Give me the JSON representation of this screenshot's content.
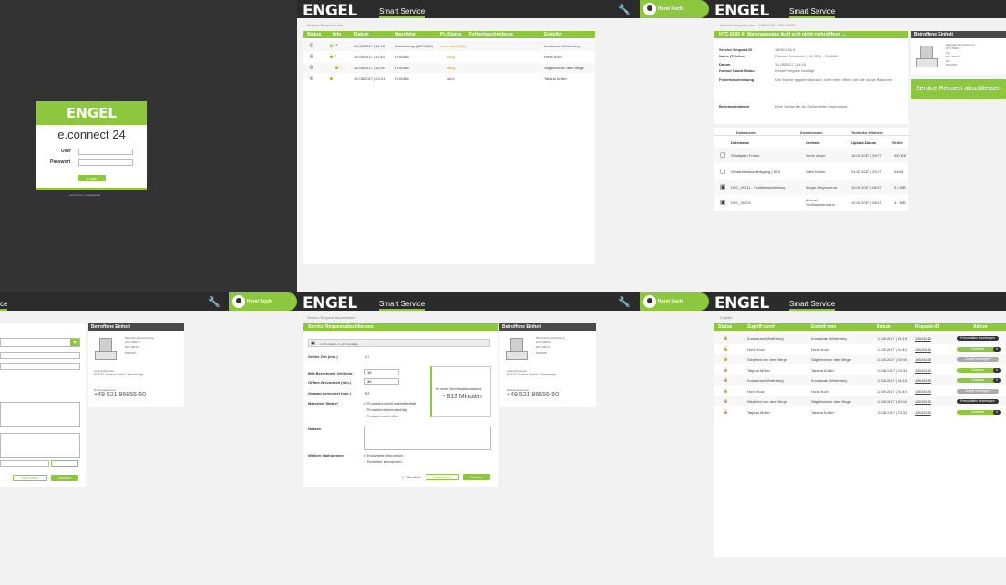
{
  "brand": "ENGEL",
  "nav_title": "Smart Service",
  "user": "Horst Koch",
  "login": {
    "logo": "ENGEL",
    "title": "e.connect 24",
    "user_label": "User",
    "password_label": "Passwort",
    "login_button": "Login",
    "powered": "powered by"
  },
  "list": {
    "breadcrumb": "Service Request Liste",
    "columns": [
      "Status",
      "Info",
      "Datum",
      "Maschine",
      "Pr.-Status",
      "Fehlerbeschreibung",
      "Ersteller"
    ],
    "rows": [
      {
        "datum": "11.08.2017 | 14:15",
        "maschine": "Maschinetyp (8874456)",
        "prio": "noch nicht fällig",
        "prio_color": "#e0a020",
        "ersteller": "Konstanze Winterberg"
      },
      {
        "datum": "11.08.2017 | 11:44",
        "maschine": "8741068",
        "prio": "fällig",
        "prio_color": "#e0a020",
        "ersteller": "Horst Koch"
      },
      {
        "datum": "11.08.2017 | 11:04",
        "maschine": "8741068",
        "prio": "fällig",
        "prio_color": "#e0a020",
        "ersteller": "Siegfried von dem Berge"
      },
      {
        "datum": "10.08.2017 | 23:31",
        "maschine": "8741068",
        "prio": "akut",
        "prio_color": "#e03030",
        "ersteller": "Tatjana Müller"
      }
    ]
  },
  "detail": {
    "breadcrumb": "Service Request Liste · 18054135 · HTC-5600",
    "header": "HTC-5600 X: Warenausgabe läuft sich nicht mehr öffnen ...",
    "fields": [
      {
        "label": "Service Request ID",
        "value": "18054135 A"
      },
      {
        "label": "Name (Telefon)",
        "value": "Renate Schneider (+49 521) - 9966500"
      },
      {
        "label": "Datum",
        "value": "11.08.2017 | 14:15"
      },
      {
        "label": "Konsul Guard Status",
        "value": "Keine Freigabe benötigt"
      },
      {
        "label": "Fehlerbeschreibung",
        "value": "Die Wanne eggabe lässt sich nicht mehr öffnen und die ganze Maschine"
      },
      {
        "label": "Begemaßnahmen",
        "value": "Eine Sichtprüfe der Sicherheiten ergebnislos"
      }
    ],
    "tabs": [
      "Dokumente",
      "Kommentare",
      "Techniker-Historie"
    ],
    "doc_cols": [
      "Dateiname",
      "Verfasst",
      "Upload-Datum",
      "Größe"
    ],
    "docs": [
      {
        "name": "Schaltplan Fronts",
        "by": "Horst Meyer",
        "date": "15.03.2017 | 09:27",
        "size": "450 KB"
      },
      {
        "name": "Gewährleistsanfertigung (.NO)",
        "by": "Gabi Körber",
        "date": "24.02.2017 | 09:27",
        "size": "54 kB"
      },
      {
        "name": "DSC_00211 - Fehlerbeschreibung",
        "by": "Jürgen Heymonroid",
        "date": "10.03.2017 | 08:37",
        "size": "3.2 MB"
      },
      {
        "name": "DSC_00224",
        "by": "Michael Großwassermann",
        "date": "10.03.2017 | 08:37",
        "size": "3.1 MB"
      }
    ],
    "unit_header": "Betroffene Einheit",
    "close_button": "Service Request abschliessen"
  },
  "unit": {
    "header": "Betroffene Einheit",
    "line1": "Maschinenbezeichnung",
    "line2": "HTC-5600 X",
    "typ_label": "Typ",
    "typ": "E17.400-KX",
    "id_label": "ID",
    "id": "8741068",
    "contact_label": "Ansprechpartner",
    "contact": "ENGEL Austria GmbH · Testanlage",
    "phone_label": "Erstkontaktperson",
    "phone": "+49 521 96655-50"
  },
  "form": {
    "breadcrumb": "Service Request abschliessen",
    "header": "Service Request abschliessen",
    "machine": "HTC-5600 X (8741068)",
    "f1": "Online Zeit (min.)",
    "v1": "67",
    "f2": "Bild Berechnete Zeit (min.)",
    "v2": "15",
    "f3": "Offline-Serviceseit (min.)",
    "v3": "30",
    "f4": "Gesamt berechnet (min.)",
    "v4": "67",
    "f5": "Maschine Status*",
    "radio": [
      "Produktion nicht beeinträchtigt",
      "Produktion beeinträchtigt",
      "Problem noch offen"
    ],
    "status_label": "Ihr neuer Serviceaufwandsstand:",
    "status_value": "- 813 Minuten",
    "notes_label": "Notizen",
    "more_label": "Weitere Maßnahmen",
    "checks": [
      "Ersatzteile erforderlich",
      "Techniker erforderlich"
    ],
    "required": "*) Pflichtfeld",
    "cancel": "Abbrechen",
    "submit": "Senden"
  },
  "access": {
    "breadcrumb": "Zugriffe",
    "columns": [
      "Status",
      "Zugriff durch",
      "Erstellt von",
      "Datum",
      "Request-ID",
      "Aktion"
    ],
    "rows": [
      {
        "by": "Konstanze Winterberg",
        "created": "Konstanze Winterberg",
        "date": "11.08.2017 | 14:15",
        "id": "18543415",
        "action": "Freischalten beantragen",
        "kind": "dark"
      },
      {
        "by": "Horst Koch",
        "created": "Horst Koch",
        "date": "11.08.2017 | 11:44",
        "id": "18543415",
        "action": "Zulassen",
        "kind": "green"
      },
      {
        "by": "Siegfried von dem Berge",
        "created": "Siegfried von dem Berge",
        "date": "11.08.2017 | 10:04",
        "id": "18543415",
        "action": "Zugriff verweigert",
        "kind": "gray"
      },
      {
        "by": "Tatjana Müller",
        "created": "Tatjana Müller",
        "date": "10.08.2017 | 23:31",
        "id": "18543415",
        "action": "Zulassen",
        "kind": "green"
      },
      {
        "by": "Konstanze Winterberg",
        "created": "Konstanze Winterberg",
        "date": "11.08.2017 | 14:15",
        "id": "18543415",
        "action": "Zulassen",
        "kind": "green"
      },
      {
        "by": "Horst Koch",
        "created": "Horst Koch",
        "date": "11.08.2017 | 11:44",
        "id": "18543415",
        "action": "Zugriff verweigert",
        "kind": "gray"
      },
      {
        "by": "Siegfried von dem Berge",
        "created": "Siegfried von dem Berge",
        "date": "11.08.2017 | 10:04",
        "id": "18543415",
        "action": "Freischalten beantragen",
        "kind": "dark"
      },
      {
        "by": "Tatjana Müller",
        "created": "Tatjana Müller",
        "date": "10.08.2017 | 23:31",
        "id": "18543415",
        "action": "Zulassen",
        "kind": "green"
      }
    ]
  },
  "partial": {
    "nav_tail": "ce",
    "send": "Senden",
    "cancel": "Abbrechen"
  }
}
